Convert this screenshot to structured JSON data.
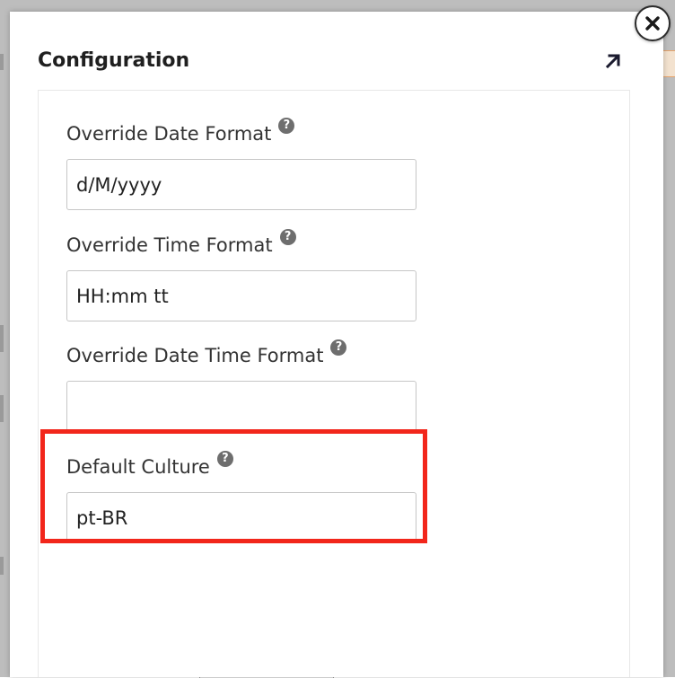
{
  "dialog": {
    "title": "Configuration"
  },
  "fields": [
    {
      "label": "Override Date Format",
      "value": "d/M/yyyy",
      "help_icon": "question-circle-icon"
    },
    {
      "label": "Override Time Format",
      "value": "HH:mm tt",
      "help_icon": "question-circle-icon"
    },
    {
      "label": "Override Date Time Format",
      "value": "",
      "help_icon": "question-circle-icon"
    },
    {
      "label": "Default Culture",
      "value": "pt-BR",
      "help_icon": "question-circle-icon",
      "highlighted": true
    }
  ],
  "icons": {
    "expand": "arrow-up-right-icon",
    "close": "close-icon",
    "help_glyph": "?"
  },
  "colors": {
    "highlight": "#f2261b",
    "help_icon_bg": "#6e6e6e",
    "title_text": "#1f1f1f"
  }
}
